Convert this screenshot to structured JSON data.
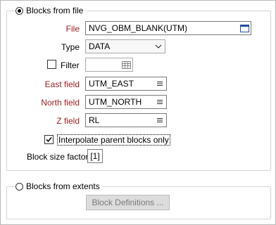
{
  "blocks_from_file": {
    "label": "Blocks from file",
    "selected": true,
    "file": {
      "label": "File",
      "value": "NVG_OBM_BLANK(UTM)",
      "icon": "file-browse-icon"
    },
    "type": {
      "label": "Type",
      "value": "DATA",
      "icon": "chevron-down-icon"
    },
    "filter": {
      "label": "Filter",
      "checked": false,
      "value": "",
      "icon": "filter-table-icon"
    },
    "east_field": {
      "label": "East field",
      "value": "UTM_EAST",
      "icon": "list-icon"
    },
    "north_field": {
      "label": "North field",
      "value": "UTM_NORTH",
      "icon": "list-icon"
    },
    "z_field": {
      "label": "Z field",
      "value": "RL",
      "icon": "list-icon"
    },
    "interpolate": {
      "label": "Interpolate parent blocks only",
      "checked": true
    },
    "block_size_factor": {
      "label": "Block size factor",
      "value": "[1]"
    }
  },
  "blocks_from_extents": {
    "label": "Blocks from extents",
    "selected": false,
    "block_definitions_button": "Block Definitions ..."
  },
  "colors": {
    "required_label": "#9b1c1c",
    "disabled_text": "#7a7a7a"
  }
}
